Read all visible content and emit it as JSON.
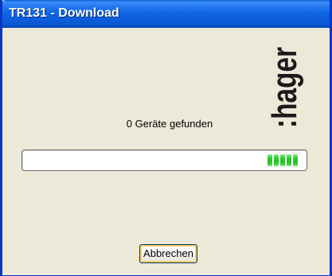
{
  "window": {
    "title": "TR131 - Download"
  },
  "logo": {
    "text": ":hager"
  },
  "status": {
    "text": "0 Geräte gefunden"
  },
  "progress": {
    "visible_chunks": 5,
    "chunk_color": "#22c022"
  },
  "buttons": {
    "cancel_label": "Abbrechen"
  },
  "colors": {
    "titlebar": "#0a56d3",
    "window_background": "#ece9d8",
    "logo": "#1a1a1a"
  }
}
